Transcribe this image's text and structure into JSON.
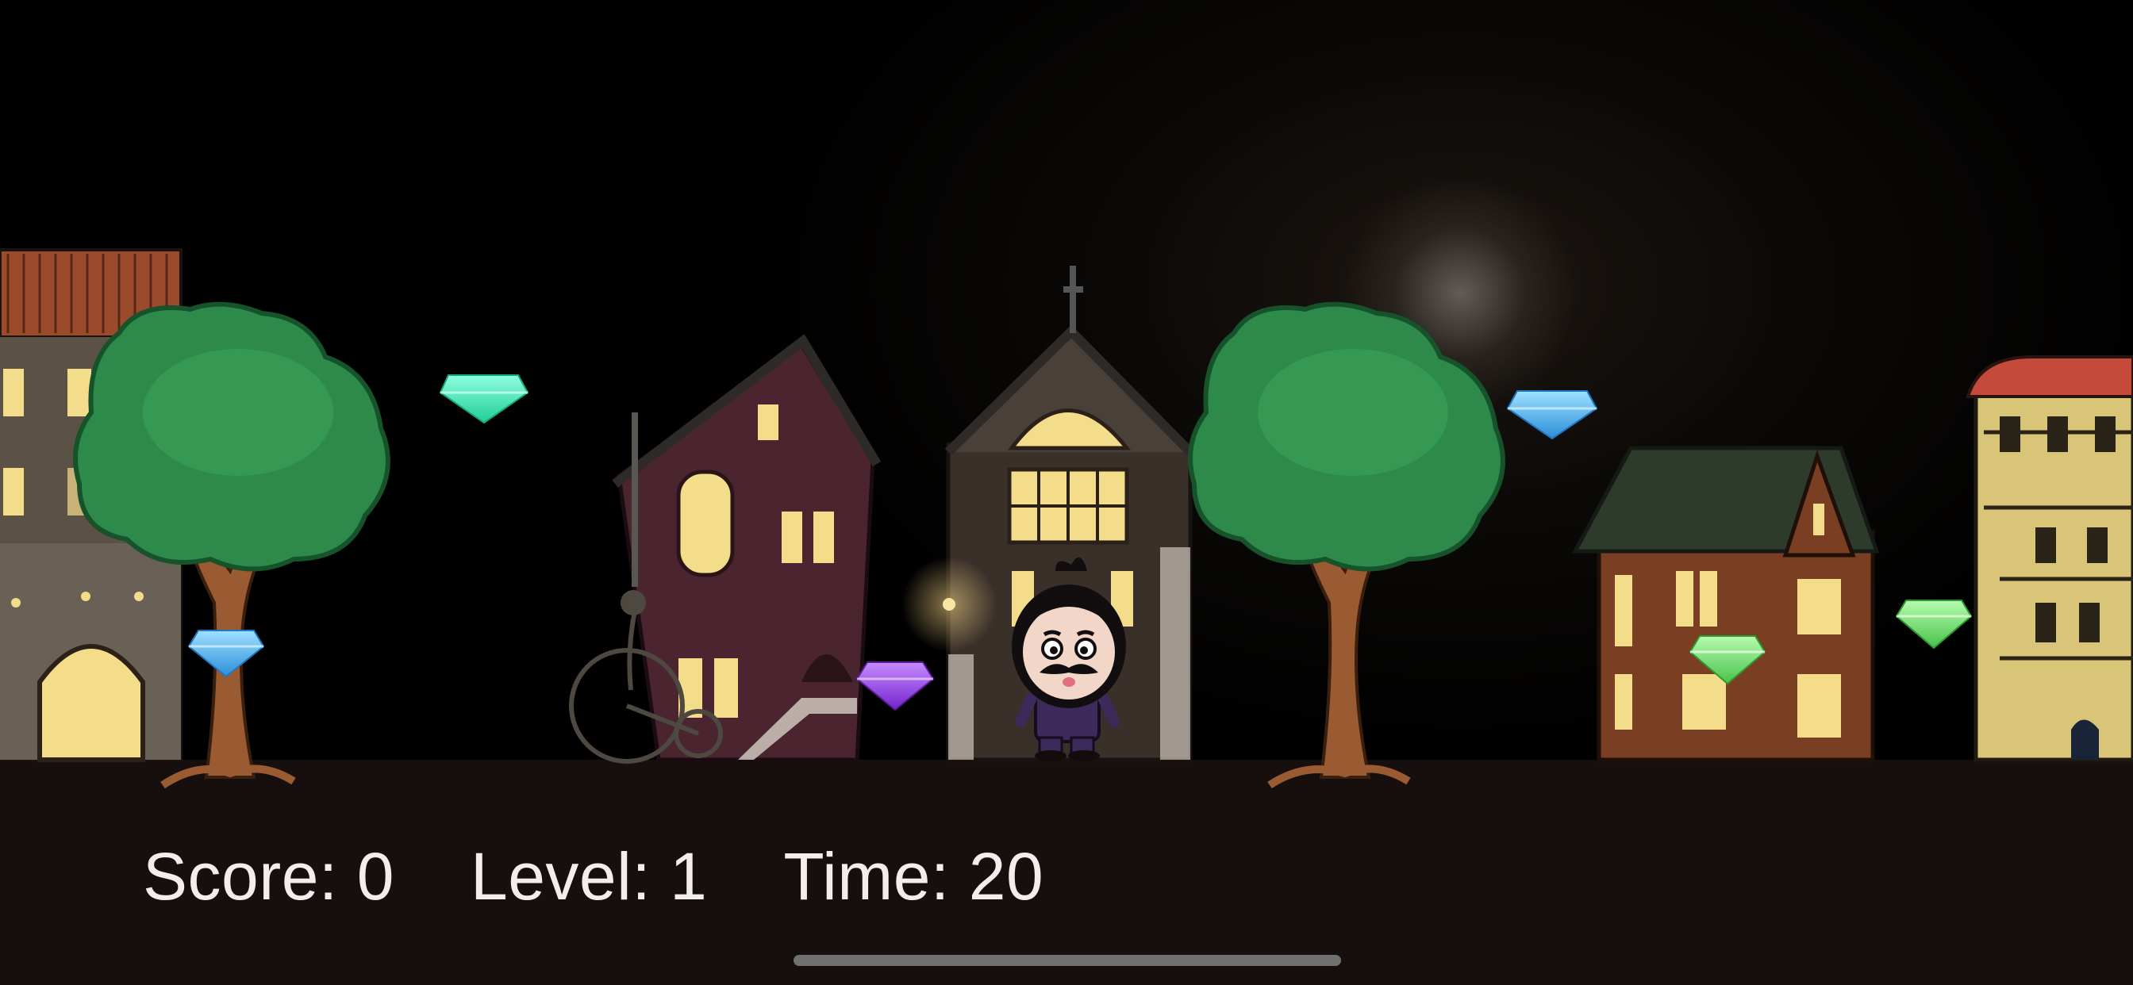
{
  "hud": {
    "score_label": "Score:",
    "score_value": "0",
    "level_label": "Level:",
    "level_value": "1",
    "time_label": "Time:",
    "time_value": "20"
  },
  "scene": {
    "gems": [
      {
        "name": "gem-teal",
        "color": "#3ff0b4"
      },
      {
        "name": "gem-blue",
        "color": "#48b8f0"
      },
      {
        "name": "gem-purple",
        "color": "#9a3ee8"
      },
      {
        "name": "gem-green",
        "color": "#6ce46c"
      }
    ],
    "colors": {
      "sky": "#000000",
      "ground": "#160f0e",
      "tree_foliage": "#2d8a4a",
      "tree_trunk": "#9a5a32",
      "window_light": "#f3dc8a",
      "character_suit": "#3b2a5a"
    }
  }
}
